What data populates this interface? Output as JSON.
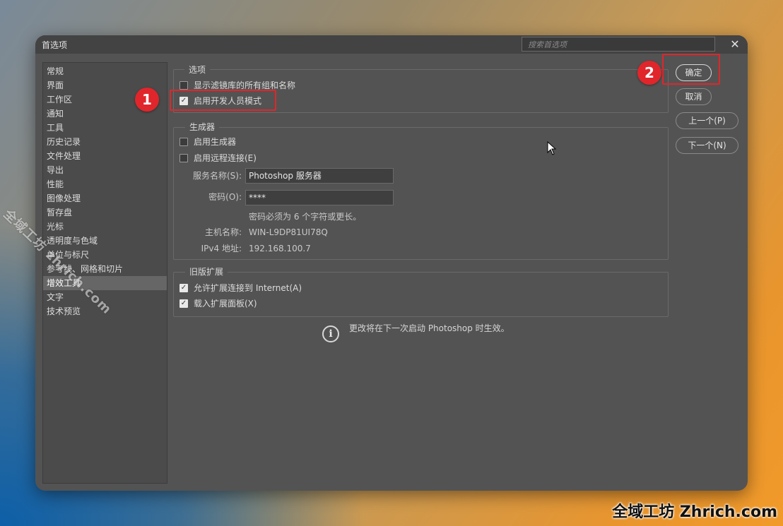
{
  "window": {
    "title": "首选项",
    "search_placeholder": "搜索首选项",
    "close_glyph": "✕"
  },
  "sidebar": {
    "items": [
      {
        "label": "常规"
      },
      {
        "label": "界面"
      },
      {
        "label": "工作区"
      },
      {
        "label": "通知"
      },
      {
        "label": "工具"
      },
      {
        "label": "历史记录"
      },
      {
        "label": "文件处理"
      },
      {
        "label": "导出"
      },
      {
        "label": "性能"
      },
      {
        "label": "图像处理"
      },
      {
        "label": "暂存盘"
      },
      {
        "label": "光标"
      },
      {
        "label": "透明度与色域"
      },
      {
        "label": "单位与标尺"
      },
      {
        "label": "参考线、网格和切片"
      },
      {
        "label": "增效工具",
        "selected": true
      },
      {
        "label": "文字"
      },
      {
        "label": "技术预览"
      }
    ]
  },
  "options_group": {
    "title": "选项",
    "show_filter_gallery": {
      "label": "显示滤镜库的所有组和名称",
      "checked": false
    },
    "developer_mode": {
      "label": "启用开发人员模式",
      "checked": true
    }
  },
  "generator_group": {
    "title": "生成器",
    "enable_generator": {
      "label": "启用生成器",
      "checked": false
    },
    "enable_remote": {
      "label": "启用远程连接(E)",
      "checked": false
    },
    "service_name_label": "服务名称(S):",
    "service_name_value": "Photoshop 服务器",
    "password_label": "密码(O):",
    "password_value": "****",
    "password_hint": "密码必须为 6 个字符或更长。",
    "hostname_label": "主机名称:",
    "hostname_value": "WIN-L9DP81UI78Q",
    "ipv4_label": "IPv4 地址:",
    "ipv4_value": "192.168.100.7"
  },
  "legacy_group": {
    "title": "旧版扩展",
    "allow_internet": {
      "label": "允许扩展连接到 Internet(A)",
      "checked": true
    },
    "load_panels": {
      "label": "载入扩展面板(X)",
      "checked": true
    }
  },
  "notice": {
    "icon": "info-icon",
    "text": "更改将在下一次启动 Photoshop 时生效。"
  },
  "buttons": {
    "ok": "确定",
    "cancel": "取消",
    "prev": "上一个(P)",
    "next": "下一个(N)"
  },
  "annotations": {
    "badge1": "1",
    "badge2": "2",
    "highlight_color": "#e0262b"
  },
  "watermark": {
    "diagonal": "全域工坊 zhrich.com",
    "corner": "全域工坊 Zhrich.com"
  }
}
